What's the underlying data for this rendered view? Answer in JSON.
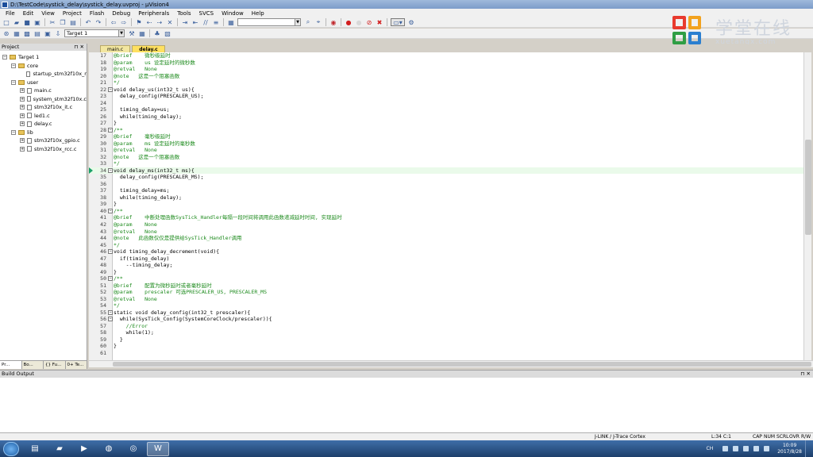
{
  "window": {
    "title": "D:\\TestCode\\systick_delay\\systick_delay.uvproj - µVision4"
  },
  "menu": [
    "File",
    "Edit",
    "View",
    "Project",
    "Flash",
    "Debug",
    "Peripherals",
    "Tools",
    "SVCS",
    "Window",
    "Help"
  ],
  "toolbar": {
    "target_select": "Target 1",
    "find_value": ""
  },
  "logo": {
    "cn": "学堂在线",
    "url": "xuetangx.com"
  },
  "project": {
    "header": "Project",
    "tree": [
      {
        "label": "Target 1",
        "indent": 0,
        "kind": "target",
        "box": "−"
      },
      {
        "label": "core",
        "indent": 1,
        "kind": "folder",
        "box": "−"
      },
      {
        "label": "startup_stm32f10x_r",
        "indent": 2,
        "kind": "file",
        "box": ""
      },
      {
        "label": "user",
        "indent": 1,
        "kind": "folder",
        "box": "−"
      },
      {
        "label": "main.c",
        "indent": 2,
        "kind": "file",
        "box": "+"
      },
      {
        "label": "system_stm32f10x.c",
        "indent": 2,
        "kind": "file",
        "box": "+"
      },
      {
        "label": "stm32f10x_it.c",
        "indent": 2,
        "kind": "file",
        "box": "+"
      },
      {
        "label": "led1.c",
        "indent": 2,
        "kind": "file",
        "box": "+"
      },
      {
        "label": "delay.c",
        "indent": 2,
        "kind": "file",
        "box": "+"
      },
      {
        "label": "lib",
        "indent": 1,
        "kind": "folder",
        "box": "−"
      },
      {
        "label": "stm32f10x_gpio.c",
        "indent": 2,
        "kind": "file",
        "box": "+"
      },
      {
        "label": "stm32f10x_rcc.c",
        "indent": 2,
        "kind": "file",
        "box": "+"
      }
    ],
    "tabs": [
      "Pr...",
      "Bo...",
      "{} Fu...",
      "0+ Te..."
    ]
  },
  "editor": {
    "tabs": [
      "main.c",
      "delay.c"
    ],
    "active_tab": "delay.c",
    "current_line": 34,
    "lines": [
      {
        "n": 17,
        "code": "@brief    微秒级延时",
        "comment": true,
        "fold": ""
      },
      {
        "n": 18,
        "code": "@param    us 设定延时的微秒数",
        "comment": true,
        "fold": ""
      },
      {
        "n": 19,
        "code": "@retval   None",
        "comment": true,
        "fold": ""
      },
      {
        "n": 20,
        "code": "@note   这是一个阻塞函数",
        "comment": true,
        "fold": ""
      },
      {
        "n": 21,
        "code": "*/",
        "comment": true,
        "fold": ""
      },
      {
        "n": 22,
        "code": "void delay_us(int32_t us){",
        "comment": false,
        "fold": "−"
      },
      {
        "n": 23,
        "code": "  delay_config(PRESCALER_US);",
        "comment": false,
        "fold": ""
      },
      {
        "n": 24,
        "code": "",
        "comment": false,
        "fold": ""
      },
      {
        "n": 25,
        "code": "  timing_delay=us;",
        "comment": false,
        "fold": ""
      },
      {
        "n": 26,
        "code": "  while(timing_delay);",
        "comment": false,
        "fold": ""
      },
      {
        "n": 27,
        "code": "}",
        "comment": false,
        "fold": ""
      },
      {
        "n": 28,
        "code": "/**",
        "comment": true,
        "fold": "−"
      },
      {
        "n": 29,
        "code": "@brief    毫秒级延时",
        "comment": true,
        "fold": ""
      },
      {
        "n": 30,
        "code": "@param    ms 设定延时的毫秒数",
        "comment": true,
        "fold": ""
      },
      {
        "n": 31,
        "code": "@retval   None",
        "comment": true,
        "fold": ""
      },
      {
        "n": 32,
        "code": "@note   这是一个阻塞函数",
        "comment": true,
        "fold": ""
      },
      {
        "n": 33,
        "code": "*/",
        "comment": true,
        "fold": ""
      },
      {
        "n": 34,
        "code": "void delay_ms(int32_t ms){",
        "comment": false,
        "fold": "−"
      },
      {
        "n": 35,
        "code": "  delay_config(PRESCALER_MS);",
        "comment": false,
        "fold": ""
      },
      {
        "n": 36,
        "code": "",
        "comment": false,
        "fold": ""
      },
      {
        "n": 37,
        "code": "  timing_delay=ms;",
        "comment": false,
        "fold": ""
      },
      {
        "n": 38,
        "code": "  while(timing_delay);",
        "comment": false,
        "fold": ""
      },
      {
        "n": 39,
        "code": "}",
        "comment": false,
        "fold": ""
      },
      {
        "n": 40,
        "code": "/**",
        "comment": true,
        "fold": "−"
      },
      {
        "n": 41,
        "code": "@brief    中断处理函数SysTick_Handler每隔一段时间将调用此函数递减延时时间, 实现延时",
        "comment": true,
        "fold": ""
      },
      {
        "n": 42,
        "code": "@param    None",
        "comment": true,
        "fold": ""
      },
      {
        "n": 43,
        "code": "@retval   None",
        "comment": true,
        "fold": ""
      },
      {
        "n": 44,
        "code": "@note   此函数仅仅是提供给SysTick_Handler调用",
        "comment": true,
        "fold": ""
      },
      {
        "n": 45,
        "code": "*/",
        "comment": true,
        "fold": ""
      },
      {
        "n": 46,
        "code": "void timing_delay_decrement(void){",
        "comment": false,
        "fold": "−"
      },
      {
        "n": 47,
        "code": "  if(timing_delay)",
        "comment": false,
        "fold": ""
      },
      {
        "n": 48,
        "code": "    --timing_delay;",
        "comment": false,
        "fold": ""
      },
      {
        "n": 49,
        "code": "}",
        "comment": false,
        "fold": ""
      },
      {
        "n": 50,
        "code": "/**",
        "comment": true,
        "fold": "−"
      },
      {
        "n": 51,
        "code": "@brief    配置为微秒延时或者毫秒延时",
        "comment": true,
        "fold": ""
      },
      {
        "n": 52,
        "code": "@param    prescaler 可选PRESCALER_US, PRESCALER_MS",
        "comment": true,
        "fold": ""
      },
      {
        "n": 53,
        "code": "@retval   None",
        "comment": true,
        "fold": ""
      },
      {
        "n": 54,
        "code": "*/",
        "comment": true,
        "fold": ""
      },
      {
        "n": 55,
        "code": "static void delay_config(int32_t prescaler){",
        "comment": false,
        "fold": "−"
      },
      {
        "n": 56,
        "code": "  while(SysTick_Config(SystemCoreClock/prescaler)){",
        "comment": false,
        "fold": "−"
      },
      {
        "n": 57,
        "code": "    //Error",
        "comment": true,
        "fold": ""
      },
      {
        "n": 58,
        "code": "    while(1);",
        "comment": false,
        "fold": ""
      },
      {
        "n": 59,
        "code": "  }",
        "comment": false,
        "fold": ""
      },
      {
        "n": 60,
        "code": "}",
        "comment": false,
        "fold": ""
      },
      {
        "n": 61,
        "code": "",
        "comment": false,
        "fold": ""
      }
    ]
  },
  "build_output": {
    "header": "Build Output"
  },
  "status": {
    "debugger": "J-LINK / J-Trace Cortex",
    "position": "L:34 C:1",
    "caps": "CAP",
    "num": "NUM",
    "scrl": "SCRL",
    "ovr": "OVR",
    "rw": "R/W"
  },
  "taskbar": {
    "ime": "CH",
    "time": "10:09",
    "date": "2017/8/28"
  },
  "colors": {
    "comment": "#1c8a1c",
    "current_line": "#eafaea",
    "tab_active": "#ffe060"
  }
}
